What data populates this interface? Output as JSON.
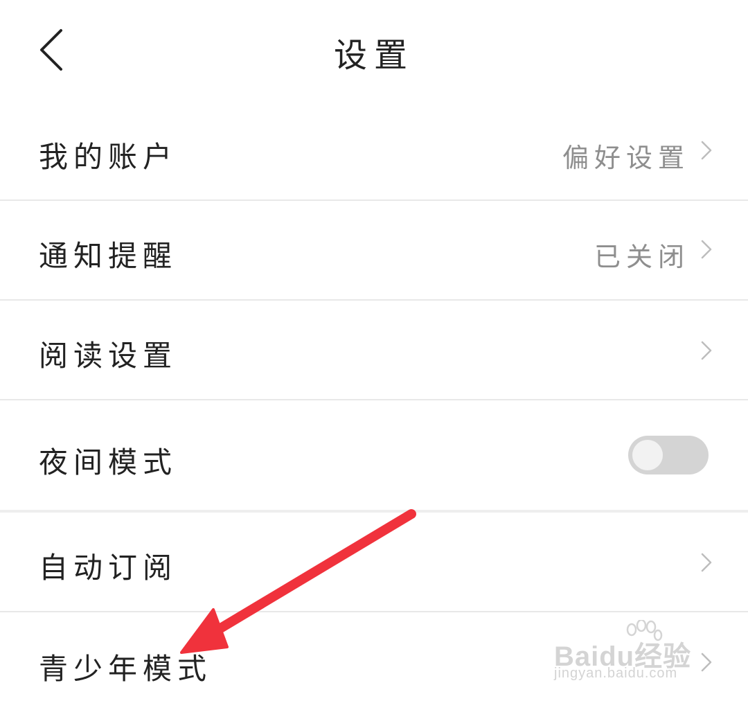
{
  "header": {
    "title": "设置",
    "back_icon": "chevron-left-icon"
  },
  "settings": [
    {
      "label": "我的账户",
      "value": "偏好设置",
      "control": "chevron"
    },
    {
      "label": "通知提醒",
      "value": "已关闭",
      "control": "chevron"
    },
    {
      "label": "阅读设置",
      "value": "",
      "control": "chevron"
    },
    {
      "label": "夜间模式",
      "value": "",
      "control": "toggle",
      "toggle_on": false
    },
    {
      "label": "自动订阅",
      "value": "",
      "control": "chevron"
    },
    {
      "label": "青少年模式",
      "value": "",
      "control": "chevron"
    }
  ],
  "annotation": {
    "arrow_color": "#f0323c",
    "points_to": "青少年模式"
  },
  "watermark": {
    "brand": "Baidu经验",
    "url": "jingyan.baidu.com"
  },
  "colors": {
    "background": "#ffffff",
    "text": "#222222",
    "secondary_text": "#8e8e8e",
    "divider": "#e8e8e8",
    "toggle_off": "#d4d4d4"
  }
}
